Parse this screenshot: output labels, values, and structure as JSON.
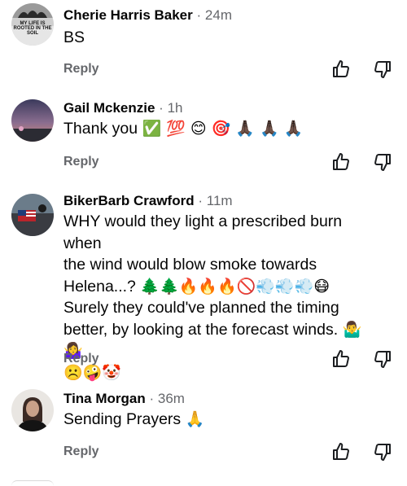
{
  "comments": [
    {
      "name": "Cherie Harris Baker",
      "time": "24m",
      "line1": "BS",
      "reply": "Reply",
      "avatar_text": "MY LIFE IS ROOTED IN THE SOIL"
    },
    {
      "name": "Gail Mckenzie",
      "time": "1h",
      "line1": "Thank you",
      "emoji1": "✅ 💯 😊 🎯 🙏🏿 🙏🏿 🙏🏿",
      "reply": "Reply"
    },
    {
      "name": "BikerBarb Crawford",
      "time": "11m",
      "line1": "WHY would they light a prescribed burn when",
      "line2": "the wind would blow smoke towards",
      "line3": "Helena...?",
      "emoji3": "🌲🌲🔥🔥🔥🚫💨💨💨😷",
      "line4": "Surely they could've planned the timing",
      "line5": "better, by looking at the forecast winds.",
      "emoji5": "🤷‍♂️🤷‍♀️",
      "emoji6": "☹️🤪🤡",
      "reply": "Reply"
    },
    {
      "name": "Tina Morgan",
      "time": "36m",
      "line1": "Sending Prayers",
      "emoji1": "🙏",
      "reply": "Reply"
    }
  ],
  "separator": "·",
  "colors": {
    "text": "#050505",
    "muted": "#65676b"
  },
  "icons": {
    "like": "thumbs-up-icon",
    "dislike": "thumbs-down-icon"
  }
}
